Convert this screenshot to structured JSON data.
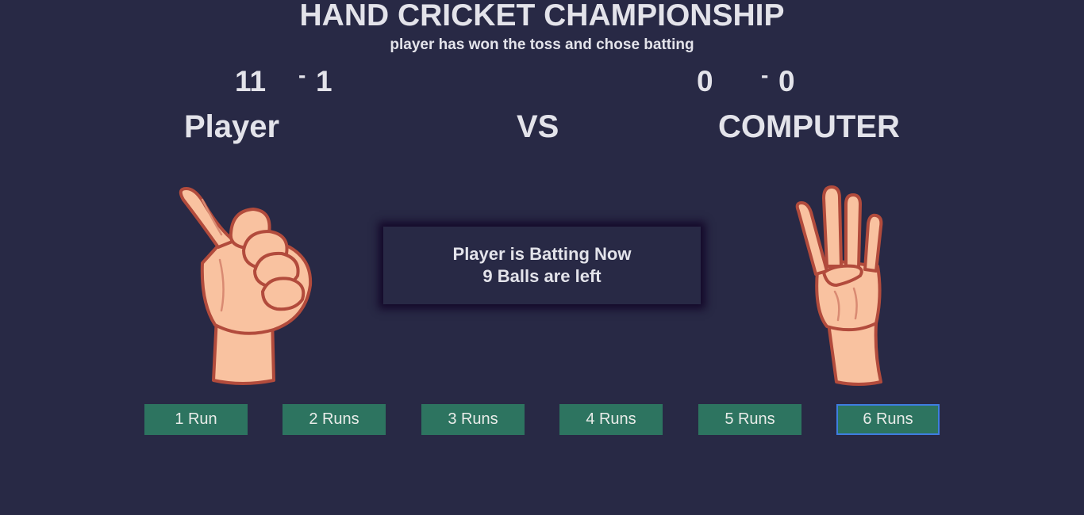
{
  "header": {
    "title": "HAND CRICKET CHAMPIONSHIP",
    "subtitle": "player has won the toss and chose batting"
  },
  "scoreboard": {
    "player": {
      "runs": "11",
      "separator": "-",
      "wickets": "1",
      "name": "Player"
    },
    "versus": "VS",
    "computer": {
      "runs": "0",
      "separator": "-",
      "wickets": "0",
      "name": "COMPUTER"
    }
  },
  "hands": {
    "player": {
      "icon": "thumbs-up-hand-icon",
      "gesture": "thumbs-up"
    },
    "computer": {
      "icon": "four-fingers-hand-icon",
      "gesture": "four fingers"
    }
  },
  "status": {
    "line1": "Player is Batting Now",
    "line2": "9 Balls are left"
  },
  "run_buttons": [
    {
      "label": "1 Run"
    },
    {
      "label": "2 Runs"
    },
    {
      "label": "3 Runs"
    },
    {
      "label": "4 Runs"
    },
    {
      "label": "5 Runs"
    },
    {
      "label": "6 Runs"
    }
  ],
  "colors": {
    "background": "#282945",
    "text": "#e3e3ea",
    "button": "#2d7460",
    "focus_ring": "#3e7de0",
    "skin": "#f9c2a0",
    "skin_outline": "#b24b3c"
  }
}
